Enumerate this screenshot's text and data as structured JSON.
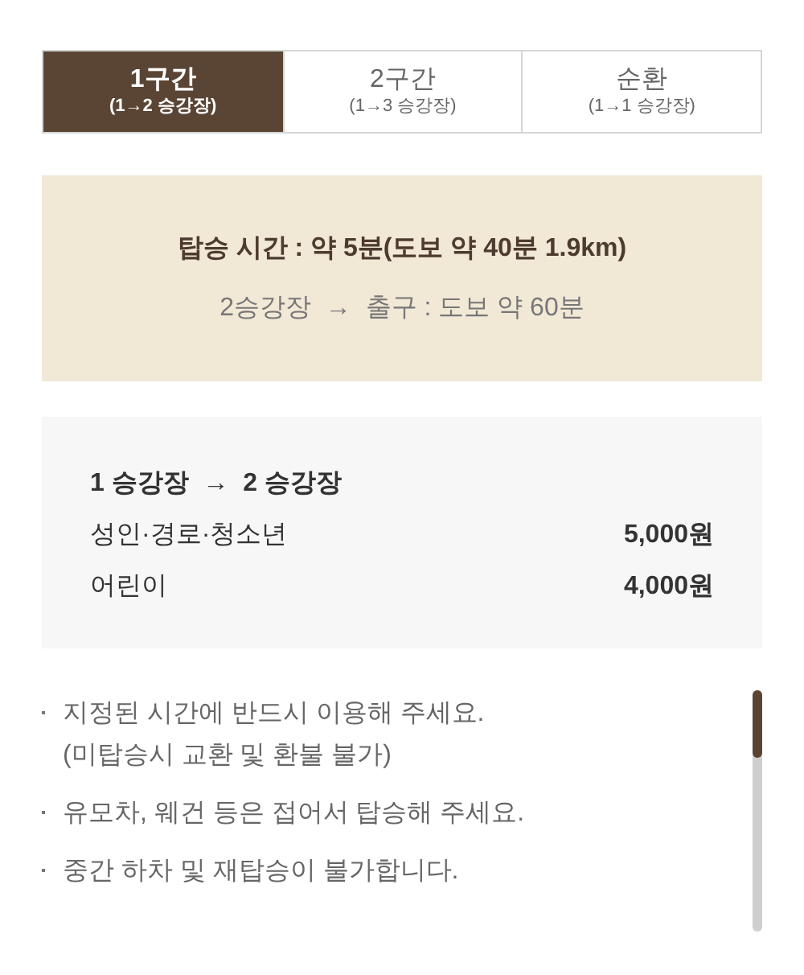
{
  "tabs": [
    {
      "title": "1구간",
      "subtitle": "(1→2 승강장)",
      "selected": true
    },
    {
      "title": "2구간",
      "subtitle": "(1→3 승강장)",
      "selected": false
    },
    {
      "title": "순환",
      "subtitle": "(1→1 승강장)",
      "selected": false
    }
  ],
  "ride_info": {
    "ride_time": "탑승 시간 : 약 5분(도보 약 40분 1.9km)",
    "exit_info": "2승강장  →  출구 : 도보 약 60분"
  },
  "fares": {
    "route": "1 승강장  →  2 승강장",
    "rows": [
      {
        "label": "성인·경로·청소년",
        "price": "5,000원"
      },
      {
        "label": "어린이",
        "price": "4,000원"
      }
    ]
  },
  "notes": [
    {
      "lines": [
        "지정된 시간에 반드시 이용해 주세요.",
        "(미탑승시 교환 및 환불 불가)"
      ]
    },
    {
      "lines": [
        "유모차, 웨건 등은 접어서 탑승해 주세요."
      ]
    },
    {
      "lines": [
        "중간 하차 및 재탑승이 불가합니다."
      ]
    }
  ]
}
